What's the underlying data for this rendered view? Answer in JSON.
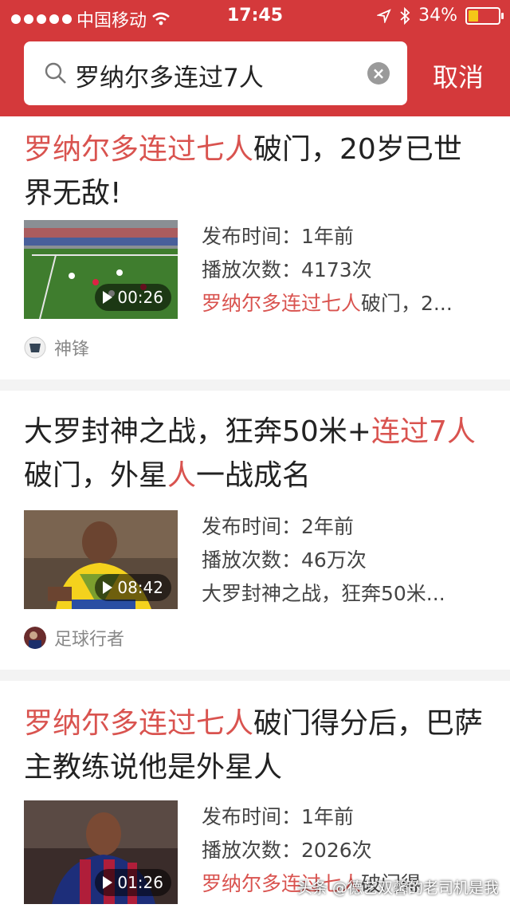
{
  "status": {
    "carrier": "中国移动",
    "time": "17:45",
    "battery": "34%"
  },
  "search": {
    "query": "罗纳尔多连过7人",
    "cancel": "取消"
  },
  "results": [
    {
      "title_parts": [
        {
          "text": "罗纳尔多连过七人",
          "hl": true
        },
        {
          "text": "破门，20岁已世界无敌!",
          "hl": false
        }
      ],
      "duration": "00:26",
      "publish_label": "发布时间：",
      "publish_value": "1年前",
      "plays_label": "播放次数：",
      "plays_value": "4173次",
      "snippet_parts": [
        {
          "text": "罗纳尔多连过七人",
          "hl": true
        },
        {
          "text": "破门，2...",
          "hl": false
        }
      ],
      "author": "神锋"
    },
    {
      "title_parts": [
        {
          "text": "大罗封神之战，狂奔50米+",
          "hl": false
        },
        {
          "text": "连过7人",
          "hl": true
        },
        {
          "text": "破门，外星",
          "hl": false
        },
        {
          "text": "人",
          "hl": true
        },
        {
          "text": "一战成名",
          "hl": false
        }
      ],
      "duration": "08:42",
      "publish_label": "发布时间：",
      "publish_value": "2年前",
      "plays_label": "播放次数：",
      "plays_value": "46万次",
      "snippet_parts": [
        {
          "text": "大罗封神之战，狂奔50米...",
          "hl": false
        }
      ],
      "author": "足球行者"
    },
    {
      "title_parts": [
        {
          "text": "罗纳尔多连过七人",
          "hl": true
        },
        {
          "text": "破门得分后，巴萨主教练说他是外星人",
          "hl": false
        }
      ],
      "duration": "01:26",
      "publish_label": "发布时间：",
      "publish_value": "1年前",
      "plays_label": "播放次数：",
      "plays_value": "2026次",
      "snippet_parts": [
        {
          "text": "罗纳尔多连过七人",
          "hl": true
        },
        {
          "text": "破门得",
          "hl": false
        }
      ],
      "author": ""
    }
  ],
  "watermark": "头条 @德艺双馨的老司机是我",
  "colors": {
    "brand": "#d4393b",
    "highlight": "#d9534f",
    "battery": "#f5c518"
  }
}
